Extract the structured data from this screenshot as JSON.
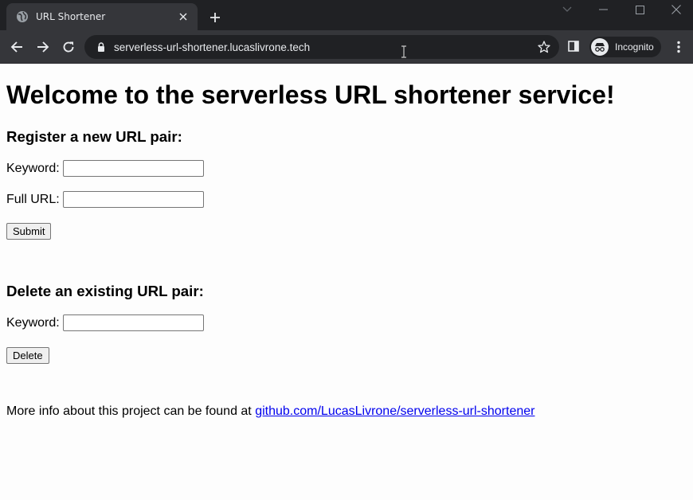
{
  "browser": {
    "tab_title": "URL Shortener",
    "url": "serverless-url-shortener.lucaslivrone.tech",
    "profile_label": "Incognito"
  },
  "page": {
    "title": "Welcome to the serverless URL shortener service!",
    "register": {
      "heading": "Register a new URL pair:",
      "keyword_label": "Keyword:",
      "keyword_value": "",
      "full_url_label": "Full URL:",
      "full_url_value": "",
      "submit_label": "Submit"
    },
    "delete": {
      "heading": "Delete an existing URL pair:",
      "keyword_label": "Keyword:",
      "keyword_value": "",
      "delete_label": "Delete"
    },
    "info": {
      "text": "More info about this project can be found at ",
      "link_text": "github.com/LucasLivrone/serverless-url-shortener"
    }
  },
  "colors": {
    "chrome_dark": "#202124",
    "chrome_toolbar": "#35363a",
    "link": "#0000ee"
  },
  "icons": [
    "globe-icon",
    "close-icon",
    "plus-icon",
    "chevron-down-icon",
    "minimize-icon",
    "maximize-icon",
    "back-arrow-icon",
    "forward-arrow-icon",
    "reload-icon",
    "lock-icon",
    "star-icon",
    "side-panel-icon",
    "incognito-icon",
    "kebab-menu-icon"
  ]
}
